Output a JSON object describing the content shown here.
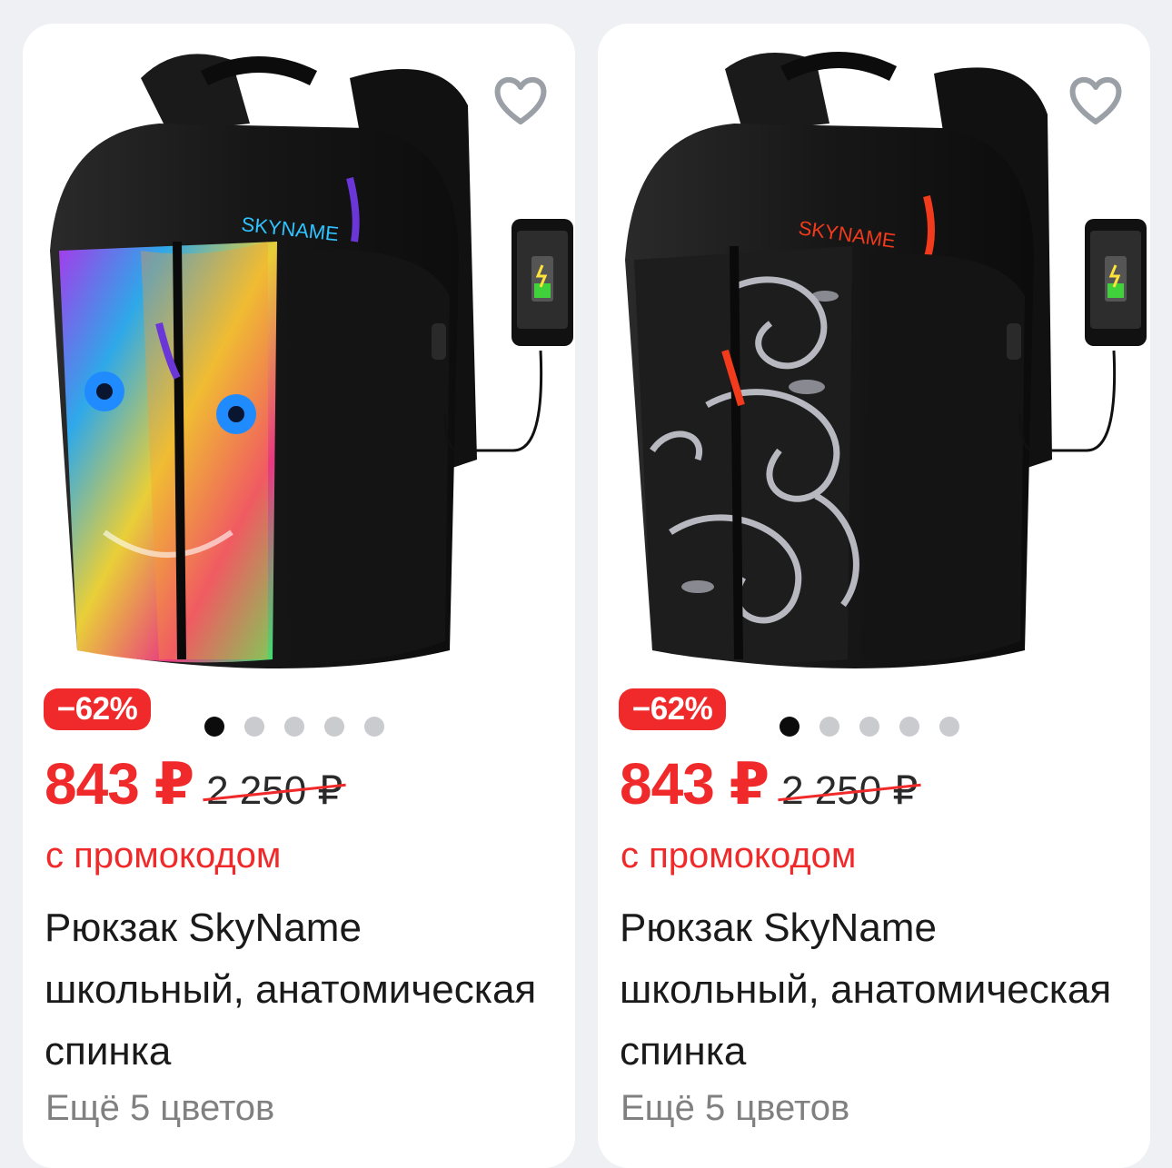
{
  "products": [
    {
      "discount": "−62%",
      "price": "843 ₽",
      "old_price": "2 250 ₽",
      "promo": "с промокодом",
      "title": "Рюкзак SkyName школьный, анатомическая спинка",
      "more_colors": "Ещё 5 цветов",
      "brand_print": "SKYNAME",
      "image_slides": 5,
      "active_slide": 1,
      "accent_color": "#6a36d8",
      "image": "backpack-colorful-lion-print"
    },
    {
      "discount": "−62%",
      "price": "843 ₽",
      "old_price": "2 250 ₽",
      "promo": "с промокодом",
      "title": "Рюкзак SkyName школьный, анатомическая спинка",
      "more_colors": "Ещё 5 цветов",
      "brand_print": "SKYNAME",
      "image_slides": 5,
      "active_slide": 1,
      "accent_color": "#f23a1c",
      "image": "backpack-grey-floral-print"
    }
  ],
  "colors": {
    "sale_red": "#f02a2a",
    "background": "#eef0f3",
    "card": "#ffffff",
    "muted": "#808080"
  },
  "icons": {
    "favorite": "heart-outline-icon"
  }
}
